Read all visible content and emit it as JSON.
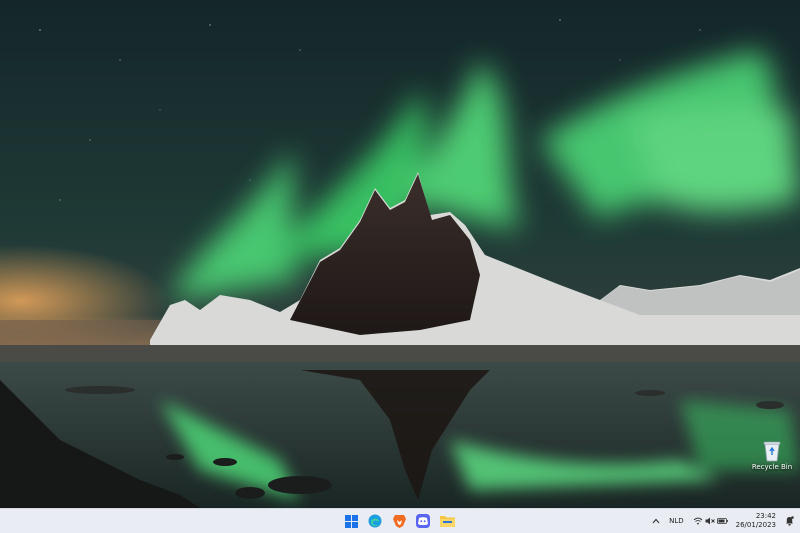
{
  "desktop": {
    "icons": [
      {
        "label": "Recycle Bin",
        "icon": "recycle-bin-icon"
      }
    ]
  },
  "taskbar": {
    "apps": [
      {
        "name": "start",
        "icon": "windows-logo-icon",
        "color": "#1a73e8"
      },
      {
        "name": "edge",
        "icon": "edge-icon",
        "color": "#1b9de2"
      },
      {
        "name": "brave",
        "icon": "brave-icon",
        "color": "#f26b22"
      },
      {
        "name": "discord",
        "icon": "discord-icon",
        "color": "#5865f2"
      },
      {
        "name": "file-explorer",
        "icon": "folder-icon",
        "color": "#f6c544"
      }
    ],
    "tray": {
      "language": "NLD",
      "time": "23:42",
      "date": "26/01/2023"
    }
  }
}
